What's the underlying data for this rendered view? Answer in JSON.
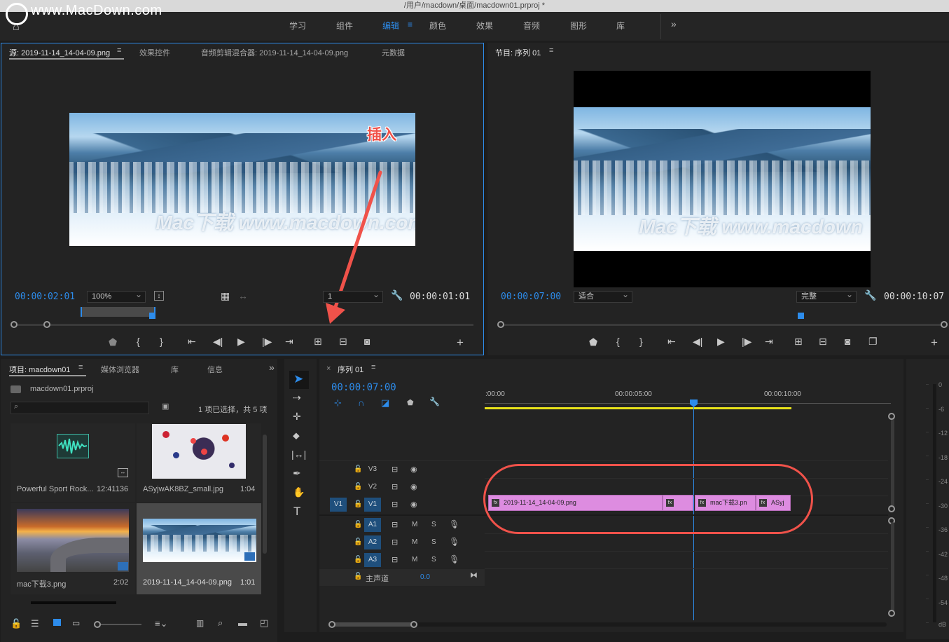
{
  "window": {
    "title": "/用户/macdown/桌面/macdown01.prproj *",
    "watermark": "www.MacDown.com"
  },
  "workspaces": [
    {
      "label": "学习",
      "active": false
    },
    {
      "label": "组件",
      "active": false
    },
    {
      "label": "编辑",
      "active": true
    },
    {
      "label": "颜色",
      "active": false
    },
    {
      "label": "效果",
      "active": false
    },
    {
      "label": "音频",
      "active": false
    },
    {
      "label": "图形",
      "active": false
    },
    {
      "label": "库",
      "active": false
    }
  ],
  "source": {
    "tabs": [
      "源: 2019-11-14_14-04-09.png",
      "效果控件",
      "音频剪辑混合器: 2019-11-14_14-04-09.png",
      "元数据"
    ],
    "timecode_in": "00:00:02:01",
    "zoom": "100%",
    "resolution": "1",
    "duration": "00:00:01:01",
    "annotation": "插入",
    "image_watermark": "Mac下载 www.macdown.com"
  },
  "program": {
    "tab": "节目: 序列 01",
    "timecode": "00:00:07:00",
    "fit": "适合",
    "quality": "完整",
    "duration": "00:00:10:07",
    "image_watermark": "Mac下载 www.macdown"
  },
  "project": {
    "tabs": [
      "项目: macdown01",
      "媒体浏览器",
      "库",
      "信息"
    ],
    "file": "macdown01.prproj",
    "selection": "1 项已选择，共 5 项",
    "items": [
      {
        "name": "Powerful Sport Rock...",
        "duration": "12:41136",
        "kind": "audio"
      },
      {
        "name": "ASyjwAK8BZ_small.jpg",
        "duration": "1:04",
        "kind": "berries"
      },
      {
        "name": "mac下载3.png",
        "duration": "2:02",
        "kind": "road"
      },
      {
        "name": "2019-11-14_14-04-09.png",
        "duration": "1:01",
        "kind": "snow"
      }
    ]
  },
  "timeline": {
    "tab": "序列 01",
    "timecode": "00:00:07:00",
    "ruler": [
      ":00:00",
      "00:00:05:00",
      "00:00:10:00"
    ],
    "video_tracks": [
      "V3",
      "V2",
      "V1"
    ],
    "audio_tracks": [
      "A1",
      "A2",
      "A3"
    ],
    "master": "主声道",
    "master_value": "0.0",
    "source_patch": "V1",
    "clips": [
      {
        "name": "2019-11-14_14-04-09.png"
      },
      {
        "name": ""
      },
      {
        "name": "mac下载3.pn"
      },
      {
        "name": "ASyj"
      }
    ],
    "track_m": "M",
    "track_s": "S"
  },
  "meter": {
    "labels": [
      "0",
      "-6",
      "-12",
      "-18",
      "-24",
      "-30",
      "-36",
      "-42",
      "-48",
      "-54",
      "dB"
    ]
  },
  "colors": {
    "accent": "#2d8ceb",
    "clip": "#dd8ce0",
    "annotation": "#f0524a"
  }
}
